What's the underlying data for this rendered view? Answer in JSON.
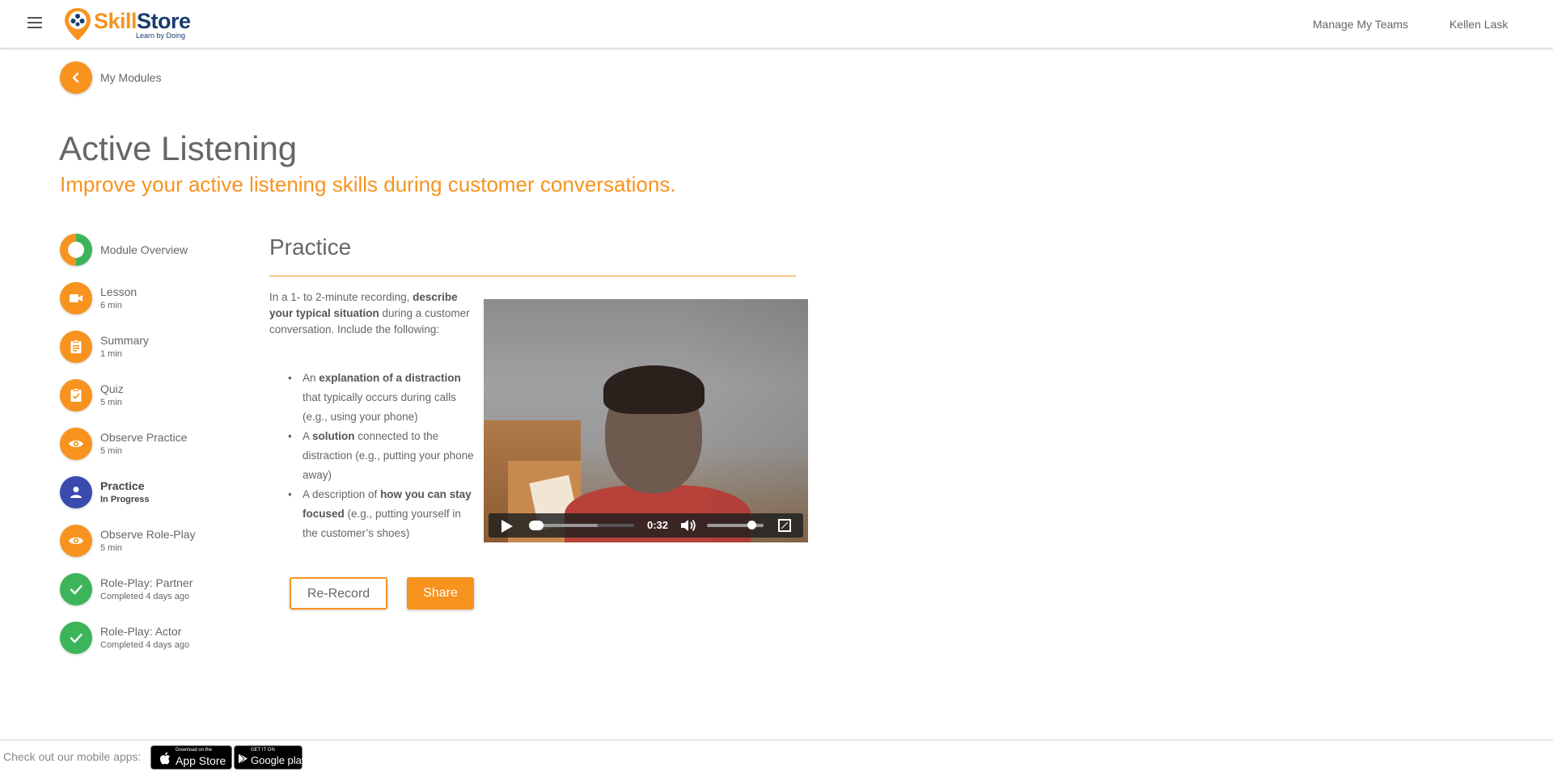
{
  "header": {
    "logo": {
      "skill": "Skill",
      "store": "Store",
      "tagline": "Learn by Doing"
    },
    "nav": [
      {
        "label": "Manage My Teams"
      },
      {
        "label": "Kellen Lask"
      }
    ]
  },
  "back": {
    "label": "My Modules"
  },
  "module": {
    "title": "Active Listening",
    "subtitle": "Improve your active listening skills during customer conversations."
  },
  "sidebar": {
    "steps": [
      {
        "label": "Module Overview",
        "sub": "",
        "icon": "donut-progress-icon",
        "state": "partial"
      },
      {
        "label": "Lesson",
        "sub": "6 min",
        "icon": "video-camera-icon",
        "state": "todo"
      },
      {
        "label": "Summary",
        "sub": "1 min",
        "icon": "clipboard-icon",
        "state": "todo"
      },
      {
        "label": "Quiz",
        "sub": "5 min",
        "icon": "clipboard-check-icon",
        "state": "todo"
      },
      {
        "label": "Observe Practice",
        "sub": "5 min",
        "icon": "eye-icon",
        "state": "todo"
      },
      {
        "label": "Practice",
        "sub": "In Progress",
        "icon": "person-icon",
        "state": "active"
      },
      {
        "label": "Observe Role-Play",
        "sub": "5 min",
        "icon": "eye-icon",
        "state": "todo"
      },
      {
        "label": "Role-Play: Partner",
        "sub": "Completed 4 days ago",
        "icon": "checkmark-icon",
        "state": "done"
      },
      {
        "label": "Role-Play: Actor",
        "sub": "Completed 4 days ago",
        "icon": "checkmark-icon",
        "state": "done"
      }
    ]
  },
  "practice": {
    "title": "Practice",
    "intro": {
      "t1": "In a 1- to 2-minute recording, ",
      "b1": "describe your typical situation",
      "t2": " during a customer conversation. Include the following:"
    },
    "bullets": [
      {
        "a": "An ",
        "b": "explanation of a distraction",
        "c": " that typically occurs during calls (e.g., using your phone)"
      },
      {
        "a": "A ",
        "b": "solution",
        "c": " connected to the distraction (e.g., putting your phone away)"
      },
      {
        "a": "A description of ",
        "b": "how you can stay focused",
        "c": " (e.g., putting yourself in the customer’s shoes)"
      }
    ],
    "video": {
      "time": "0:32",
      "progress": 0.0,
      "buffered": 0.65,
      "volume": 0.85
    },
    "buttons": {
      "rerecord": "Re-Record",
      "share": "Share"
    }
  },
  "footer": {
    "text": "Check out our mobile apps:",
    "appstore": {
      "small": "Download on the",
      "big": "App Store"
    },
    "googleplay": {
      "small": "GET IT ON",
      "big": "Google play"
    }
  },
  "colors": {
    "accent": "#f7931e",
    "brand_dark": "#1a3a6e",
    "complete": "#3cb55a",
    "active": "#3a4bb0"
  }
}
